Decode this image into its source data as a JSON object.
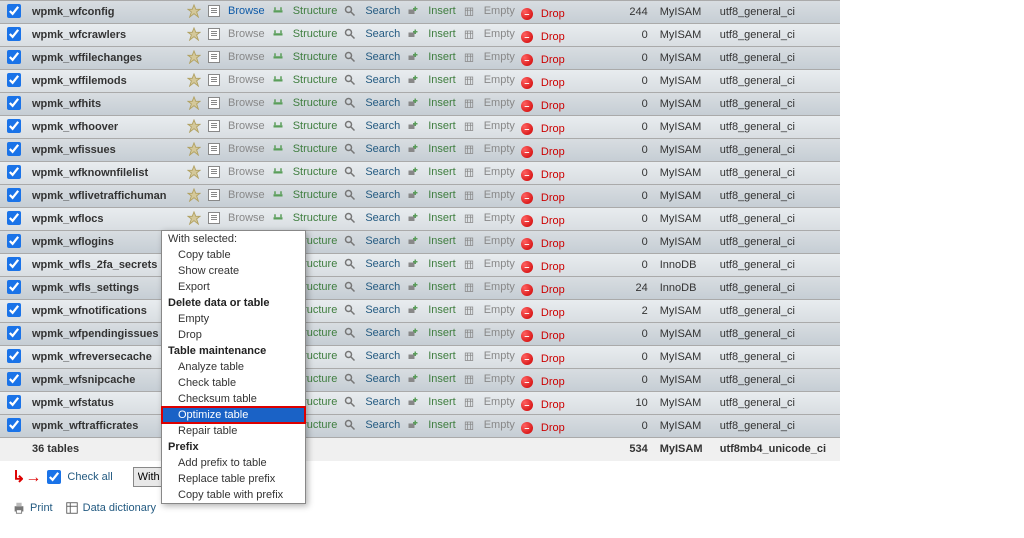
{
  "actions": {
    "browse": "Browse",
    "structure": "Structure",
    "search": "Search",
    "insert": "Insert",
    "empty": "Empty",
    "drop": "Drop"
  },
  "tables": [
    {
      "name": "wpmk_wfconfig",
      "checked": true,
      "rows": "244",
      "engine": "MyISAM",
      "collation": "utf8_general_ci",
      "hasRows": true
    },
    {
      "name": "wpmk_wfcrawlers",
      "checked": true,
      "rows": "0",
      "engine": "MyISAM",
      "collation": "utf8_general_ci",
      "hasRows": false
    },
    {
      "name": "wpmk_wffilechanges",
      "checked": true,
      "rows": "0",
      "engine": "MyISAM",
      "collation": "utf8_general_ci",
      "hasRows": false
    },
    {
      "name": "wpmk_wffilemods",
      "checked": true,
      "rows": "0",
      "engine": "MyISAM",
      "collation": "utf8_general_ci",
      "hasRows": false
    },
    {
      "name": "wpmk_wfhits",
      "checked": true,
      "rows": "0",
      "engine": "MyISAM",
      "collation": "utf8_general_ci",
      "hasRows": false
    },
    {
      "name": "wpmk_wfhoover",
      "checked": true,
      "rows": "0",
      "engine": "MyISAM",
      "collation": "utf8_general_ci",
      "hasRows": false
    },
    {
      "name": "wpmk_wfissues",
      "checked": true,
      "rows": "0",
      "engine": "MyISAM",
      "collation": "utf8_general_ci",
      "hasRows": false
    },
    {
      "name": "wpmk_wfknownfilelist",
      "checked": true,
      "rows": "0",
      "engine": "MyISAM",
      "collation": "utf8_general_ci",
      "hasRows": false
    },
    {
      "name": "wpmk_wflivetraffichuman",
      "checked": true,
      "rows": "0",
      "engine": "MyISAM",
      "collation": "utf8_general_ci",
      "hasRows": false
    },
    {
      "name": "wpmk_wflocs",
      "checked": true,
      "rows": "0",
      "engine": "MyISAM",
      "collation": "utf8_general_ci",
      "hasRows": false
    },
    {
      "name": "wpmk_wflogins",
      "checked": true,
      "rows": "0",
      "engine": "MyISAM",
      "collation": "utf8_general_ci",
      "hasRows": false
    },
    {
      "name": "wpmk_wfls_2fa_secrets",
      "checked": true,
      "rows": "0",
      "engine": "InnoDB",
      "collation": "utf8_general_ci",
      "hasRows": false
    },
    {
      "name": "wpmk_wfls_settings",
      "checked": true,
      "rows": "24",
      "engine": "InnoDB",
      "collation": "utf8_general_ci",
      "hasRows": true
    },
    {
      "name": "wpmk_wfnotifications",
      "checked": true,
      "rows": "2",
      "engine": "MyISAM",
      "collation": "utf8_general_ci",
      "hasRows": true
    },
    {
      "name": "wpmk_wfpendingissues",
      "checked": true,
      "rows": "0",
      "engine": "MyISAM",
      "collation": "utf8_general_ci",
      "hasRows": false
    },
    {
      "name": "wpmk_wfreversecache",
      "checked": true,
      "rows": "0",
      "engine": "MyISAM",
      "collation": "utf8_general_ci",
      "hasRows": false
    },
    {
      "name": "wpmk_wfsnipcache",
      "checked": true,
      "rows": "0",
      "engine": "MyISAM",
      "collation": "utf8_general_ci",
      "hasRows": false
    },
    {
      "name": "wpmk_wfstatus",
      "checked": true,
      "rows": "10",
      "engine": "MyISAM",
      "collation": "utf8_general_ci",
      "hasRows": true
    },
    {
      "name": "wpmk_wftrafficrates",
      "checked": true,
      "rows": "0",
      "engine": "MyISAM",
      "collation": "utf8_general_ci",
      "hasRows": false
    }
  ],
  "summary": {
    "label": "36 tables",
    "rows": "534",
    "engine": "MyISAM",
    "collation": "utf8mb4_unicode_ci"
  },
  "footer": {
    "checkall": "Check all",
    "withselected": "With selected:"
  },
  "bottom": {
    "print": "Print",
    "dict": "Data dictionary"
  },
  "menu": {
    "header": "With selected:",
    "items": [
      {
        "label": "Copy table",
        "type": "itm"
      },
      {
        "label": "Show create",
        "type": "itm"
      },
      {
        "label": "Export",
        "type": "itm"
      },
      {
        "label": "Delete data or table",
        "type": "grp"
      },
      {
        "label": "Empty",
        "type": "itm"
      },
      {
        "label": "Drop",
        "type": "itm"
      },
      {
        "label": "Table maintenance",
        "type": "grp"
      },
      {
        "label": "Analyze table",
        "type": "itm"
      },
      {
        "label": "Check table",
        "type": "itm"
      },
      {
        "label": "Checksum table",
        "type": "itm"
      },
      {
        "label": "Optimize table",
        "type": "itm",
        "sel": true
      },
      {
        "label": "Repair table",
        "type": "itm"
      },
      {
        "label": "Prefix",
        "type": "grp"
      },
      {
        "label": "Add prefix to table",
        "type": "itm"
      },
      {
        "label": "Replace table prefix",
        "type": "itm"
      },
      {
        "label": "Copy table with prefix",
        "type": "itm"
      }
    ]
  }
}
